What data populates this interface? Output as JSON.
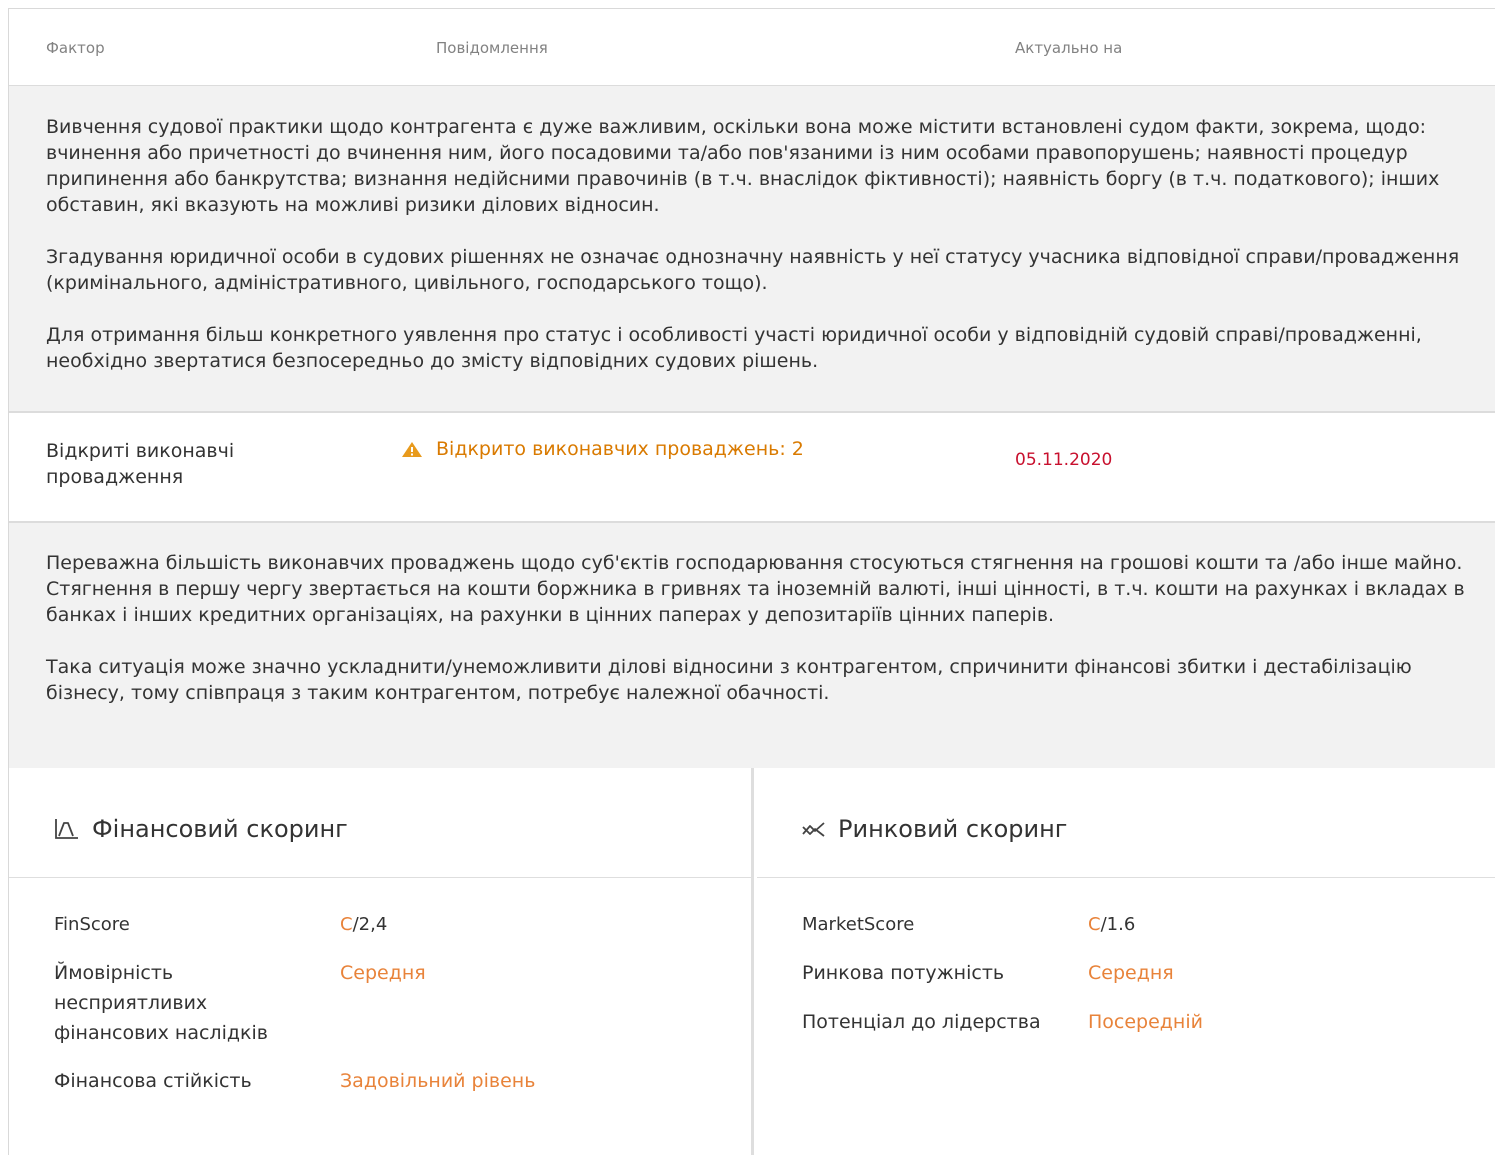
{
  "table_header": {
    "factor": "Фактор",
    "message": "Повідомлення",
    "actual_on": "Актуально на"
  },
  "court_note": {
    "p1": "Вивчення судової практики щодо контрагента є дуже важливим, оскільки вона може містити встановлені судом факти, зокрема, щодо: вчинення або причетності до вчинення ним, його посадовими та/або пов'язаними із ним особами правопорушень; наявності процедур припинення або банкрутства; визнання недійсними правочинів (в т.ч. внаслідок фіктивності); наявність боргу (в т.ч. податкового); інших обставин, які вказують на можливі ризики ділових відносин.",
    "p2": "Згадування юридичної особи в судових рішеннях не означає однозначну наявність у неї статусу учасника відповідної справи/провадження (кримінального, адміністративного, цивільного, господарського тощо).",
    "p3": "Для отримання більш конкретного уявлення про статус і особливості участі юридичної особи у відповідній судовій справі/провадженні, необхідно звертатися безпосередньо до змісту відповідних судових рішень."
  },
  "enforcement_row": {
    "factor": "Відкриті виконавчі провадження",
    "message": "Відкрито виконавчих проваджень: 2",
    "date": "05.11.2020",
    "icon": "warning-icon",
    "message_color": "#d97a00",
    "date_color": "#c8102e"
  },
  "enforcement_note": {
    "p1": "Переважна більшість виконавчих проваджень щодо суб'єктів господарювання стосуються стягнення на грошові кошти та /або інше майно. Стягнення в першу чергу звертається на кошти боржника в гривнях та іноземній валюті, інші цінності, в т.ч. кошти на рахунках і вкладах в банках і інших кредитних організаціях, на рахунки в цінних паперах у депозитаріїв цінних паперів.",
    "p2": "Така ситуація може значно ускладнити/унеможливити ділові відносини з контрагентом, спричинити фінансові збитки і дестабілізацію бізнесу, тому співпраця з таким контрагентом, потребує належної обачності."
  },
  "fin_scoring": {
    "title": "Фінансовий скоринг",
    "icon": "chart-icon",
    "finscore_label": "FinScore",
    "finscore_grade": "C",
    "finscore_value": "/2,4",
    "risk_label": "Ймовірність несприятливих фінансових наслідків",
    "risk_value": "Середня",
    "stability_label": "Фінансова стійкість",
    "stability_value": "Задовільний рівень"
  },
  "market_scoring": {
    "title": "Ринковий скоринг",
    "icon": "trend-icon",
    "marketscore_label": "MarketScore",
    "marketscore_grade": "C",
    "marketscore_value": "/1.6",
    "power_label": "Ринкова потужність",
    "power_value": "Середня",
    "leadership_label": "Потенціал до лідерства",
    "leadership_value": "Посередній"
  },
  "colors": {
    "accent": "#e8833a",
    "note_bg": "#f2f2f2"
  }
}
